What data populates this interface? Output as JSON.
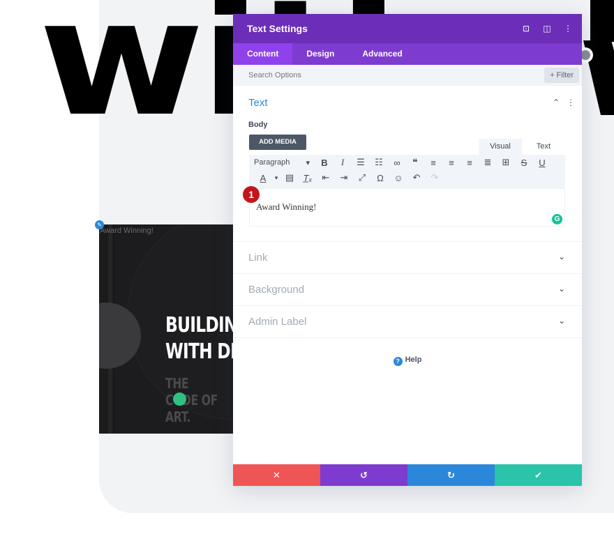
{
  "background": {
    "big_word": "with",
    "book": {
      "award_label": "Award Winning!",
      "title_line1": "BUILDING",
      "title_line2": "WITH DIVI",
      "sub_line1": "THE",
      "sub_line2": "CODE OF",
      "sub_line3": "ART."
    }
  },
  "modal": {
    "title": "Text Settings",
    "header_icons": [
      "focus-icon",
      "split-view-icon",
      "more-vert-icon"
    ],
    "tabs": [
      {
        "label": "Content",
        "active": true
      },
      {
        "label": "Design",
        "active": false
      },
      {
        "label": "Advanced",
        "active": false
      }
    ],
    "search": {
      "placeholder": "Search Options",
      "value": ""
    },
    "filter_label": "+ Filter",
    "text_section": {
      "heading": "Text",
      "body_label": "Body",
      "add_media_label": "ADD MEDIA",
      "mode_tabs": [
        {
          "label": "Visual",
          "active": true
        },
        {
          "label": "Text",
          "active": false
        }
      ],
      "toolbar": {
        "format_select": "Paragraph",
        "row1": [
          "B",
          "I",
          "≡",
          "≡",
          "🔗",
          "❝",
          "≡",
          "≡",
          "≡",
          "≡",
          "⊞▾",
          "S",
          "U"
        ],
        "row2": [
          "A▾",
          "📋",
          "Tx",
          "⇤",
          "⇥",
          "⤢",
          "Ω",
          "☺",
          "↶",
          "↷"
        ]
      },
      "editor_content": "Award Winning!",
      "step_badge": "1",
      "grammarly": "G"
    },
    "collapsed_sections": [
      "Link",
      "Background",
      "Admin Label"
    ],
    "help_label": "Help",
    "footer": {
      "cancel": "✕",
      "undo": "↺",
      "redo": "↻",
      "save": "✔"
    },
    "colors": {
      "header": "#6c2eb9",
      "tabs": "#7e3bd0",
      "active_tab": "#8f42ec",
      "cancel": "#ef5555",
      "undo": "#7e3bd0",
      "redo": "#2b87da",
      "save": "#29c4a9",
      "accent": "#2b87da"
    }
  }
}
